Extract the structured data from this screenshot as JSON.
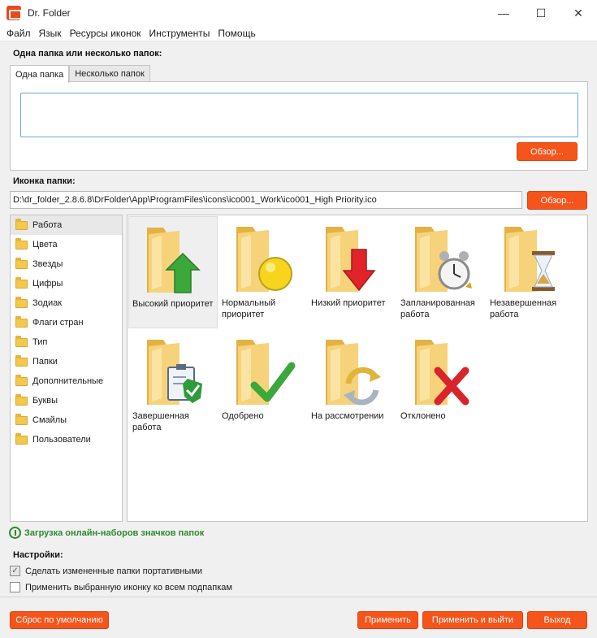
{
  "window": {
    "title": "Dr. Folder",
    "minimize": "—",
    "maximize": "☐",
    "close": "✕"
  },
  "menu": [
    "Файл",
    "Язык",
    "Ресурсы иконок",
    "Инструменты",
    "Помощь"
  ],
  "folders_section": {
    "label": "Одна папка или несколько папок:",
    "tabs": [
      "Одна папка",
      "Несколько папок"
    ],
    "active_tab": 0,
    "input_value": "",
    "browse_label": "Обзор..."
  },
  "icon_section": {
    "label": "Иконка папки:",
    "path": "D:\\dr_folder_2.8.6.8\\DrFolder\\App\\ProgramFiles\\icons\\ico001_Work\\ico001_High Priority.ico",
    "browse_label": "Обзор..."
  },
  "categories": [
    {
      "label": "Работа",
      "selected": true
    },
    {
      "label": "Цвета"
    },
    {
      "label": "Звезды"
    },
    {
      "label": "Цифры"
    },
    {
      "label": "Зодиак"
    },
    {
      "label": "Флаги стран"
    },
    {
      "label": "Тип"
    },
    {
      "label": "Папки"
    },
    {
      "label": "Дополнительные"
    },
    {
      "label": "Буквы"
    },
    {
      "label": "Смайлы"
    },
    {
      "label": "Пользователи"
    }
  ],
  "icons": [
    {
      "label": "Высокий приоритет",
      "overlay": "up-arrow-icon",
      "selected": true
    },
    {
      "label": "Нормальный приоритет",
      "overlay": "yellow-circle-icon"
    },
    {
      "label": "Низкий приоритет",
      "overlay": "down-arrow-icon"
    },
    {
      "label": "Запланированная работа",
      "overlay": "alarm-clock-icon"
    },
    {
      "label": "Незавершенная работа",
      "overlay": "hourglass-icon"
    },
    {
      "label": "Завершенная работа",
      "overlay": "clipboard-check-icon"
    },
    {
      "label": "Одобрено",
      "overlay": "checkmark-icon"
    },
    {
      "label": "На рассмотрении",
      "overlay": "refresh-arrows-icon"
    },
    {
      "label": "Отклонено",
      "overlay": "red-cross-icon"
    }
  ],
  "online_link": "Загрузка онлайн-наборов значков папок",
  "settings": {
    "label": "Настройки:",
    "options": [
      {
        "label": "Сделать измененные папки портативными",
        "checked": true
      },
      {
        "label": "Применить выбранную иконку ко всем подпапкам",
        "checked": false
      }
    ]
  },
  "buttons": {
    "reset": "Сброс по умолчанию",
    "apply": "Применить",
    "apply_exit": "Применить и выйти",
    "exit": "Выход"
  },
  "colors": {
    "accent": "#f5541b",
    "link": "#2b8a2b",
    "folder": "#f2c94c"
  }
}
